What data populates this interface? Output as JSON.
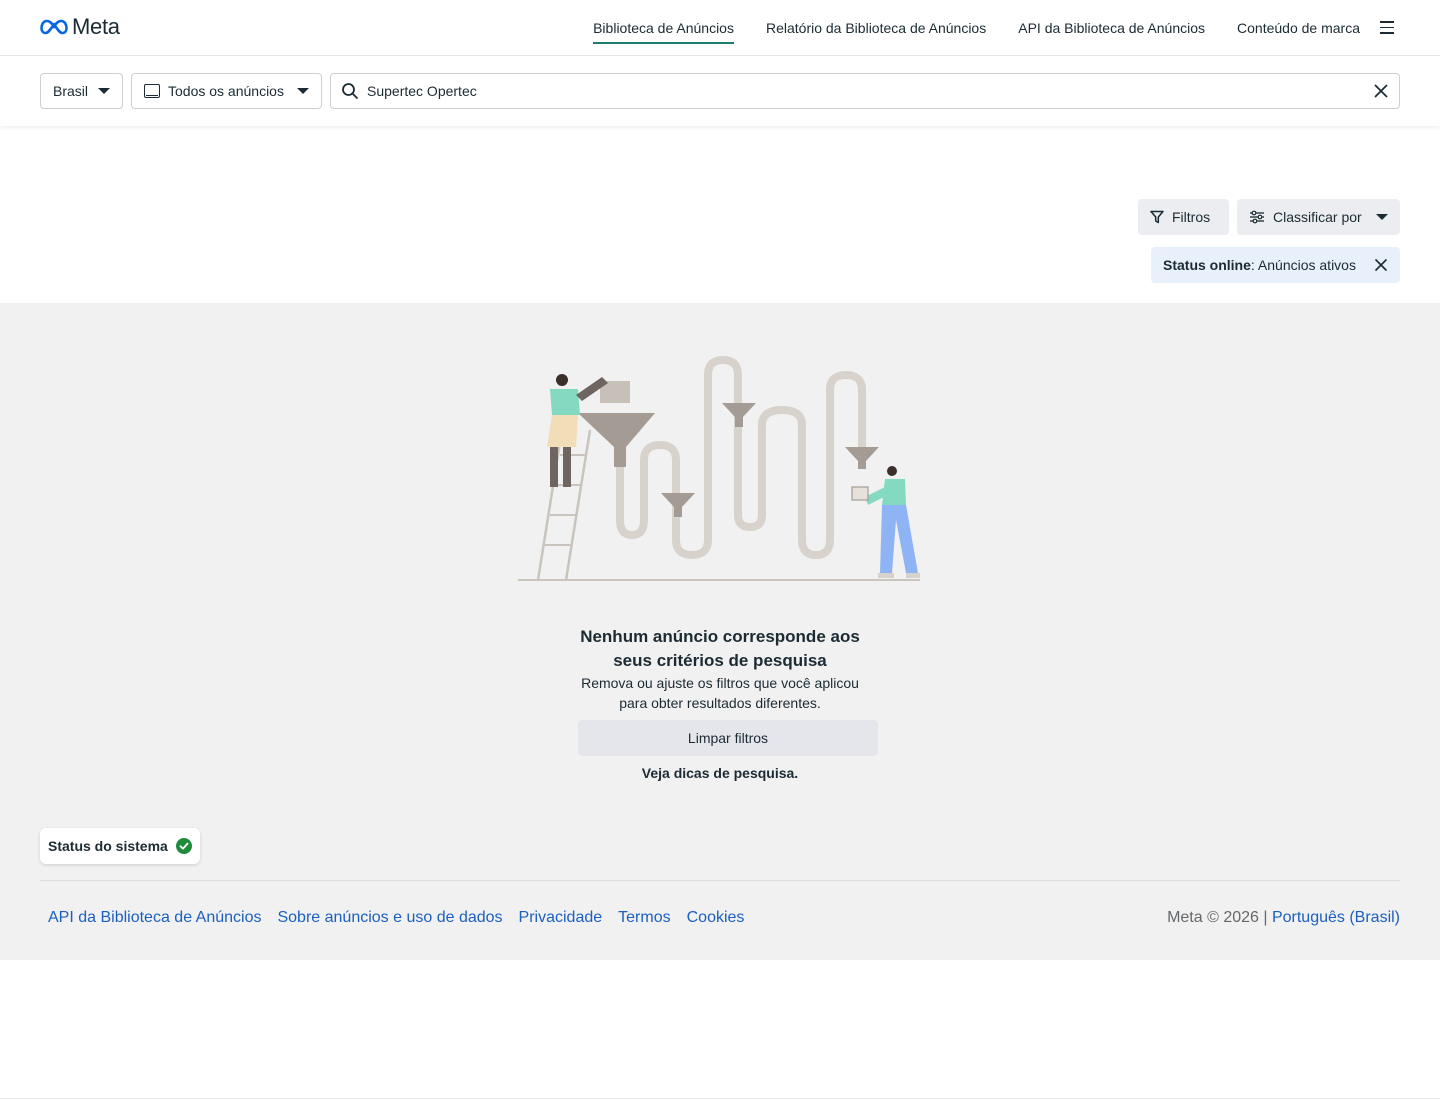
{
  "brand": {
    "name": "Meta",
    "logo_icon": "meta-infinity-icon",
    "color": "#0668e1"
  },
  "nav": {
    "links": [
      {
        "label": "Biblioteca de Anúncios",
        "active": true
      },
      {
        "label": "Relatório da Biblioteca de Anúncios",
        "active": false
      },
      {
        "label": "API da Biblioteca de Anúncios",
        "active": false
      },
      {
        "label": "Conteúdo de marca",
        "active": false
      }
    ],
    "menu_icon": "hamburger-menu-icon",
    "active_underline_color": "#1a7d70"
  },
  "search": {
    "country": "Brasil",
    "ad_type": "Todos os anúncios",
    "query": "Supertec Opertec",
    "search_icon": "search-icon",
    "clear_icon": "close-icon"
  },
  "filters": {
    "filter_label": "Filtros",
    "sort_label": "Classificar por",
    "chip_key": "Status online",
    "chip_value": ": Anúncios ativos",
    "chip_color": "#e7f0fb"
  },
  "empty_state": {
    "title": "Nenhum anúncio corresponde aos seus critérios de pesquisa",
    "subtitle": "Remova ou ajuste os filtros que você aplicou para obter resultados diferentes.",
    "clear_button": "Limpar filtros",
    "tips_link": "Veja dicas de pesquisa."
  },
  "system_status": {
    "label": "Status do sistema",
    "ok_color": "#1f8b3c"
  },
  "footer": {
    "links": [
      "API da Biblioteca de Anúncios",
      "Sobre anúncios e uso de dados",
      "Privacidade",
      "Termos",
      "Cookies"
    ],
    "copyright": "Meta © 2026 | ",
    "language": "Português (Brasil)",
    "link_color": "#1b5fc1"
  }
}
